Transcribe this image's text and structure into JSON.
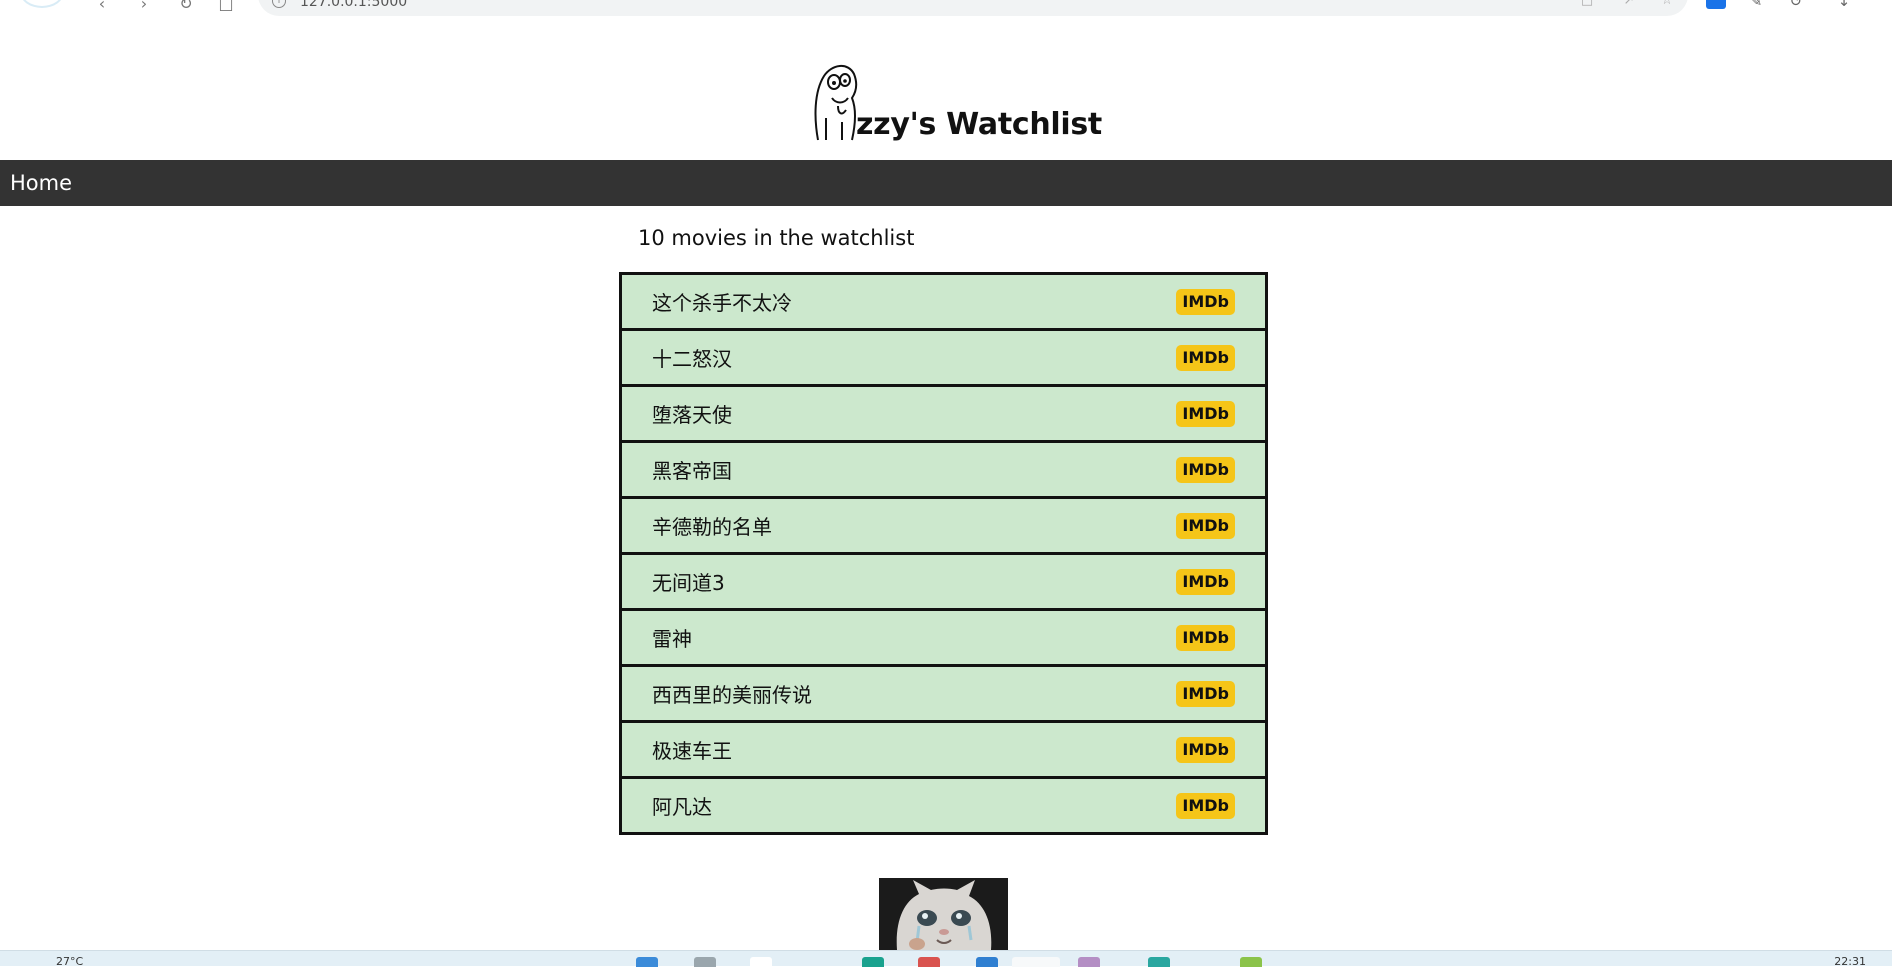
{
  "browser": {
    "address": "127.0.0.1:5000",
    "nav_icons": [
      "browser-logo-icon",
      "back-icon",
      "forward-icon",
      "refresh-icon",
      "home-icon"
    ],
    "toolbar_icons": [
      "translate-icon",
      "favorites-icon",
      "collections-icon",
      "history-icon",
      "downloads-icon"
    ]
  },
  "header": {
    "title": "zzy's Watchlist",
    "logo_icon": "ghost-doodle-icon"
  },
  "nav": {
    "home_label": "Home"
  },
  "main": {
    "count_text": "10 movies in the watchlist",
    "movies": [
      {
        "title": "这个杀手不太冷",
        "link_label": "IMDb"
      },
      {
        "title": "十二怒汉",
        "link_label": "IMDb"
      },
      {
        "title": "堕落天使",
        "link_label": "IMDb"
      },
      {
        "title": "黑客帝国",
        "link_label": "IMDb"
      },
      {
        "title": "辛德勒的名单",
        "link_label": "IMDb"
      },
      {
        "title": "无间道3",
        "link_label": "IMDb"
      },
      {
        "title": "雷神",
        "link_label": "IMDb"
      },
      {
        "title": "西西里的美丽传说",
        "link_label": "IMDb"
      },
      {
        "title": "极速车王",
        "link_label": "IMDb"
      },
      {
        "title": "阿凡达",
        "link_label": "IMDb"
      }
    ]
  },
  "footer_image": "crying-cat-image",
  "taskbar": {
    "weather": "27°C",
    "clock": "22:31"
  },
  "colors": {
    "nav_bg": "#333333",
    "row_bg": "#cce8cd",
    "imdb_badge": "#f5c518"
  }
}
